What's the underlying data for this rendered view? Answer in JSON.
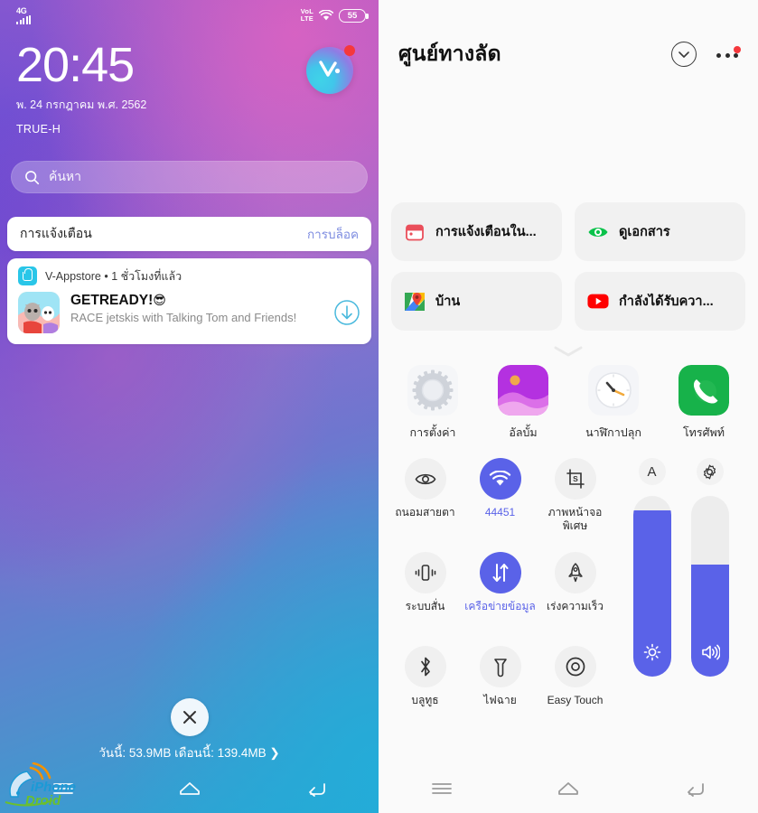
{
  "left": {
    "status_bar": {
      "network_type": "4G",
      "volte_line1": "VoLTE",
      "volte_label": "VoLTE",
      "battery_percent": "55",
      "signal_icon": "signal-bars-icon",
      "wifi_icon": "wifi-icon"
    },
    "clock": {
      "time": "20:45",
      "date": "พ. 24 กรกฎาคม พ.ศ. 2562",
      "carrier": "TRUE-H"
    },
    "badge": {
      "name": "v-appstore-badge",
      "has_unread_dot": true
    },
    "search": {
      "placeholder": "ค้นหา",
      "icon": "search-icon"
    },
    "notification_header": {
      "title": "การแจ้งเตือน",
      "action": "การบล็อค"
    },
    "notification": {
      "source": "V-Appstore",
      "separator": "•",
      "time": "1 ชั่วโมงที่แล้ว",
      "title": "GETREADY!",
      "title_emoji": "😎",
      "body": "RACE jetskis with Talking Tom and Friends!",
      "download_icon": "download-arrow-icon",
      "app_icon": "talking-tom-icon"
    },
    "close_button": {
      "icon": "close-icon"
    },
    "data_usage": "วันนี้: 53.9MB เดือนนี้: 139.4MB ❯",
    "navbar": [
      {
        "name": "recents-button",
        "icon": "menu-lines-icon"
      },
      {
        "name": "home-button",
        "icon": "home-icon"
      },
      {
        "name": "back-button",
        "icon": "back-arrow-icon"
      }
    ],
    "watermark": {
      "line1": "iPhoneDroid",
      "line2": "Droid"
    }
  },
  "right": {
    "header": {
      "title": "ศูนย์ทางลัด",
      "collapse_icon": "chevron-down-circle-icon",
      "more_icon": "more-options-icon",
      "more_has_badge": true
    },
    "cards": [
      {
        "label": "การแจ้งเตือนใน...",
        "icon": "calendar-icon",
        "color": "#ea4e5a"
      },
      {
        "label": "ดูเอกสาร",
        "icon": "eye-icon",
        "color": "#0ac24a"
      },
      {
        "label": "บ้าน",
        "icon": "google-maps-icon",
        "color": "#34a853"
      },
      {
        "label": "กำลังได้รับควา...",
        "icon": "youtube-icon",
        "color": "#ff0000"
      }
    ],
    "expand_icon": "chevron-down-icon",
    "apps": [
      {
        "label": "การตั้งค่า",
        "icon": "settings-gear-icon"
      },
      {
        "label": "อัลบั้ม",
        "icon": "gallery-album-icon"
      },
      {
        "label": "นาฬิกาปลุก",
        "icon": "alarm-clock-icon"
      },
      {
        "label": "โทรศัพท์",
        "icon": "phone-icon"
      }
    ],
    "toggles": [
      {
        "label": "ถนอมสายตา",
        "icon": "eye-comfort-icon",
        "active": false
      },
      {
        "label": "44451",
        "icon": "wifi-icon",
        "active": true
      },
      {
        "label": "ภาพหน้าจอพิเศษ",
        "icon": "screenshot-icon",
        "active": false
      },
      {
        "label": "ระบบสั่น",
        "icon": "vibrate-icon",
        "active": false
      },
      {
        "label": "เครือข่ายข้อมูล",
        "icon": "mobile-data-icon",
        "active": true
      },
      {
        "label": "เร่งความเร็ว",
        "icon": "rocket-boost-icon",
        "active": false
      },
      {
        "label": "บลูทูธ",
        "icon": "bluetooth-icon",
        "active": false
      },
      {
        "label": "ไฟฉาย",
        "icon": "flashlight-icon",
        "active": false
      },
      {
        "label": "Easy Touch",
        "icon": "easy-touch-icon",
        "active": false
      }
    ],
    "sliders": [
      {
        "name": "brightness-slider",
        "top_label": "A",
        "top_icon": "auto-brightness-icon",
        "glyph_icon": "brightness-sun-icon",
        "value": 92
      },
      {
        "name": "volume-slider",
        "top_label": "",
        "top_icon": "sound-settings-gear-icon",
        "glyph_icon": "volume-speaker-icon",
        "value": 62
      }
    ],
    "navbar": [
      {
        "name": "recents-button",
        "icon": "menu-lines-icon"
      },
      {
        "name": "home-button",
        "icon": "home-icon"
      },
      {
        "name": "back-button",
        "icon": "back-arrow-icon"
      }
    ]
  },
  "colors": {
    "accent": "#5a62e8",
    "badge_red": "#f5383c",
    "card_bg": "#f1f1f1"
  }
}
